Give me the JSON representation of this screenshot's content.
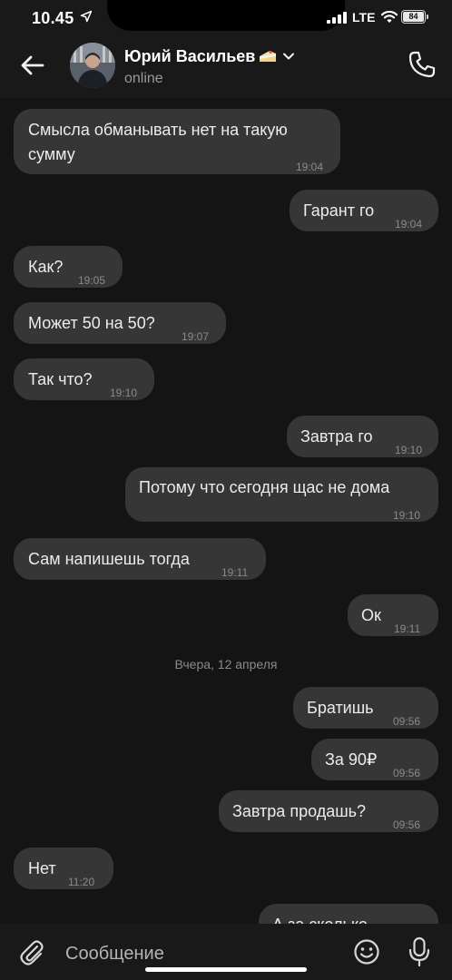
{
  "status_bar": {
    "time": "10.45",
    "network": "LTE",
    "battery": "84"
  },
  "header": {
    "contact_name": "Юрий Васильев",
    "status": "online"
  },
  "messages": [
    {
      "text_lines": [
        "Смысла обманывать нет на такую",
        "сумму"
      ],
      "time": "19:04",
      "side": "in"
    },
    {
      "text": "Гарант го",
      "time": "19:04",
      "side": "out"
    },
    {
      "text": "Как?",
      "time": "19:05",
      "side": "in"
    },
    {
      "text": "Может 50 на 50?",
      "time": "19:07",
      "side": "in"
    },
    {
      "text": "Так что?",
      "time": "19:10",
      "side": "in"
    },
    {
      "text": "Завтра го",
      "time": "19:10",
      "side": "out"
    },
    {
      "text": "Потому что сегодня щас не дома",
      "time": "19:10",
      "side": "out"
    },
    {
      "text": "Сам напишешь тогда",
      "time": "19:11",
      "side": "in"
    },
    {
      "text": "Ок",
      "time": "19:11",
      "side": "out"
    },
    {
      "text": "Братишь",
      "time": "09:56",
      "side": "out"
    },
    {
      "text": "За 90₽",
      "time": "09:56",
      "side": "out"
    },
    {
      "text": "Завтра продашь?",
      "time": "09:56",
      "side": "out"
    },
    {
      "text": "Нет",
      "time": "11:20",
      "side": "in"
    },
    {
      "text": "А за сколько",
      "side": "out"
    }
  ],
  "date_separator": "Вчера, 12 апреля",
  "input": {
    "placeholder": "Сообщение"
  }
}
